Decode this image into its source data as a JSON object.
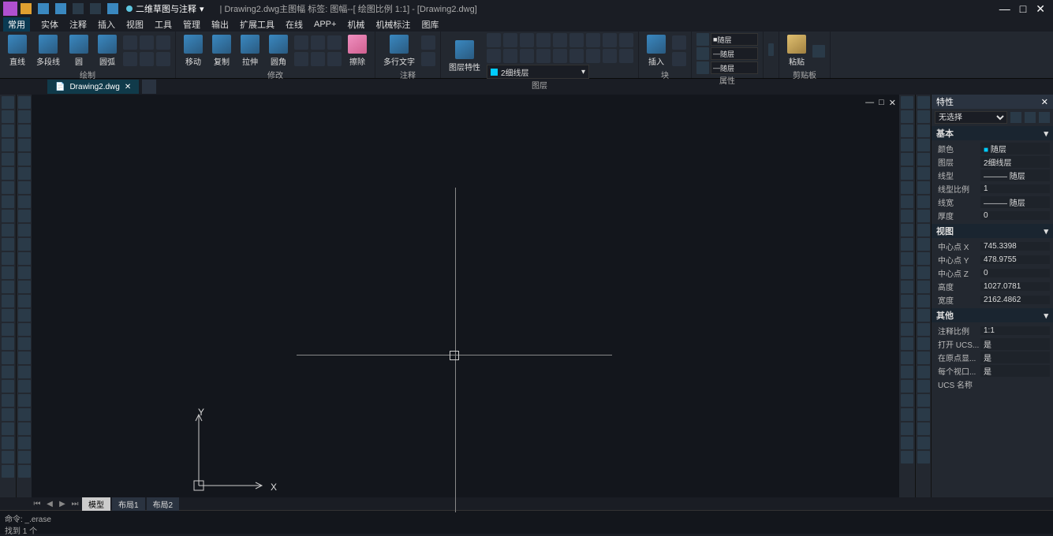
{
  "title": "| Drawing2.dwg主图幅  标签: 图幅--[ 绘图比例 1:1] - [Drawing2.dwg]",
  "workspace": "二维草图与注释",
  "menus": [
    "常用",
    "实体",
    "注释",
    "插入",
    "视图",
    "工具",
    "管理",
    "输出",
    "扩展工具",
    "在线",
    "APP+",
    "机械",
    "机械标注",
    "图库"
  ],
  "ribbon": {
    "draw": {
      "label": "绘制",
      "btns": [
        {
          "l": "直线"
        },
        {
          "l": "多段线"
        },
        {
          "l": "圆"
        },
        {
          "l": "圆弧"
        }
      ]
    },
    "modify": {
      "label": "修改",
      "btns": [
        {
          "l": "移动"
        },
        {
          "l": "复制"
        },
        {
          "l": "拉伸"
        },
        {
          "l": "圆角"
        },
        {
          "l": "擦除"
        }
      ]
    },
    "annot": {
      "label": "注释",
      "btns": [
        {
          "l": "多行文字"
        }
      ]
    },
    "layer": {
      "label": "图层",
      "btns": [
        {
          "l": "图层特性"
        }
      ],
      "combo": "2细线层"
    },
    "block": {
      "label": "块",
      "btns": [
        {
          "l": "插入"
        }
      ]
    },
    "props": {
      "label": "属性",
      "bylayer": "随层",
      "combo1": "随层"
    },
    "util": {
      "label": ""
    },
    "clip": {
      "label": "剪贴板",
      "btns": [
        {
          "l": "粘贴"
        }
      ]
    }
  },
  "filetab": {
    "name": "Drawing2.dwg"
  },
  "bottomtabs": {
    "model": "模型",
    "l1": "布局1",
    "l2": "布局2"
  },
  "cmd": {
    "prompt": "命令: _.erase",
    "result": "找到 1 个"
  },
  "prop": {
    "title": "特性",
    "sel": "无选择",
    "basic": {
      "h": "基本",
      "color": "随层",
      "layer": "2细线层",
      "ltype": "随层",
      "ltscale": "1",
      "lweight": "随层",
      "thick": "0",
      "k_color": "颜色",
      "k_layer": "图层",
      "k_ltype": "线型",
      "k_ltscale": "线型比例",
      "k_lweight": "线宽",
      "k_thick": "厚度"
    },
    "view": {
      "h": "视图",
      "cx": "745.3398",
      "cy": "478.9755",
      "cz": "0",
      "height": "1027.0781",
      "width": "2162.4862",
      "k_cx": "中心点 X",
      "k_cy": "中心点 Y",
      "k_cz": "中心点 Z",
      "k_height": "高度",
      "k_width": "宽度"
    },
    "other": {
      "h": "其他",
      "annoscale": "1:1",
      "ucsopen": "是",
      "origin": "是",
      "perview": "是",
      "ucsname": "",
      "k_annoscale": "注释比例",
      "k_ucsopen": "打开 UCS...",
      "k_origin": "在原点显...",
      "k_perview": "每个视口...",
      "k_ucsname": "UCS 名称"
    }
  },
  "ucs": {
    "x": "X",
    "y": "Y"
  }
}
